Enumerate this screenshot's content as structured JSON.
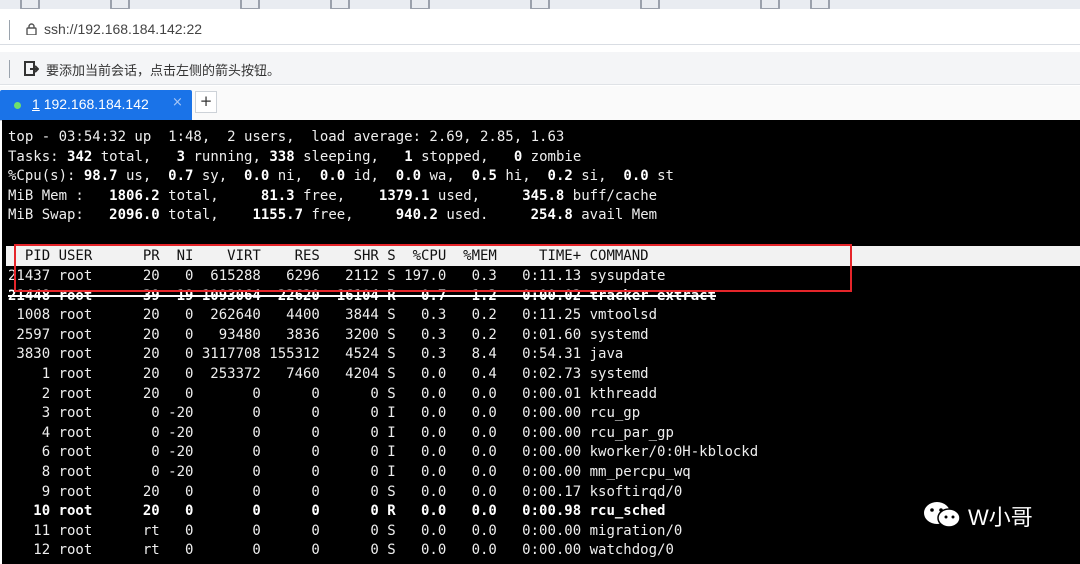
{
  "address": {
    "url": "ssh://192.168.184.142:22"
  },
  "hint": {
    "text": "要添加当前会话，点击左侧的箭头按钮。"
  },
  "tab": {
    "number": "1",
    "host": "192.168.184.142",
    "close": "×",
    "new": "+"
  },
  "terminal": {
    "summary": [
      [
        {
          "t": "top - 03:54:32 up  1:48,  2 users,  load average: 2.69, 2.85, 1.63"
        }
      ],
      [
        {
          "t": "Tasks: "
        },
        {
          "t": "342",
          "b": true
        },
        {
          "t": " total,   "
        },
        {
          "t": "3",
          "b": true
        },
        {
          "t": " running, "
        },
        {
          "t": "338",
          "b": true
        },
        {
          "t": " sleeping,   "
        },
        {
          "t": "1",
          "b": true
        },
        {
          "t": " stopped,   "
        },
        {
          "t": "0",
          "b": true
        },
        {
          "t": " zombie"
        }
      ],
      [
        {
          "t": "%Cpu(s): "
        },
        {
          "t": "98.7",
          "b": true
        },
        {
          "t": " us,  "
        },
        {
          "t": "0.7",
          "b": true
        },
        {
          "t": " sy,  "
        },
        {
          "t": "0.0",
          "b": true
        },
        {
          "t": " ni,  "
        },
        {
          "t": "0.0",
          "b": true
        },
        {
          "t": " id,  "
        },
        {
          "t": "0.0",
          "b": true
        },
        {
          "t": " wa,  "
        },
        {
          "t": "0.5",
          "b": true
        },
        {
          "t": " hi,  "
        },
        {
          "t": "0.2",
          "b": true
        },
        {
          "t": " si,  "
        },
        {
          "t": "0.0",
          "b": true
        },
        {
          "t": " st"
        }
      ],
      [
        {
          "t": "MiB Mem :   "
        },
        {
          "t": "1806.2",
          "b": true
        },
        {
          "t": " total,     "
        },
        {
          "t": "81.3",
          "b": true
        },
        {
          "t": " free,    "
        },
        {
          "t": "1379.1",
          "b": true
        },
        {
          "t": " used,     "
        },
        {
          "t": "345.8",
          "b": true
        },
        {
          "t": " buff/cache"
        }
      ],
      [
        {
          "t": "MiB Swap:   "
        },
        {
          "t": "2096.0",
          "b": true
        },
        {
          "t": " total,    "
        },
        {
          "t": "1155.7",
          "b": true
        },
        {
          "t": " free,     "
        },
        {
          "t": "940.2",
          "b": true
        },
        {
          "t": " used.     "
        },
        {
          "t": "254.8",
          "b": true
        },
        {
          "t": " avail Mem"
        }
      ]
    ],
    "header": "  PID USER      PR  NI    VIRT    RES    SHR S  %CPU  %MEM     TIME+ COMMAND",
    "rows": [
      {
        "t": "21437 root      20   0  615288   6296   2112 S 197.0   0.3   0:11.13 sysupdate"
      },
      {
        "t": "21448 root      39  19 1093064  22620  16104 R   0.7   1.2   0:00.02 tracker-extract",
        "style": "strike"
      },
      {
        "t": " 1008 root      20   0  262640   4400   3844 S   0.3   0.2   0:11.25 vmtoolsd"
      },
      {
        "t": " 2597 root      20   0   93480   3836   3200 S   0.3   0.2   0:01.60 systemd"
      },
      {
        "t": " 3830 root      20   0 3117708 155312   4524 S   0.3   8.4   0:54.31 java"
      },
      {
        "t": "    1 root      20   0  253372   7460   4204 S   0.0   0.4   0:02.73 systemd"
      },
      {
        "t": "    2 root      20   0       0      0      0 S   0.0   0.0   0:00.01 kthreadd"
      },
      {
        "t": "    3 root       0 -20       0      0      0 I   0.0   0.0   0:00.00 rcu_gp"
      },
      {
        "t": "    4 root       0 -20       0      0      0 I   0.0   0.0   0:00.00 rcu_par_gp"
      },
      {
        "t": "    6 root       0 -20       0      0      0 I   0.0   0.0   0:00.00 kworker/0:0H-kblockd"
      },
      {
        "t": "    8 root       0 -20       0      0      0 I   0.0   0.0   0:00.00 mm_percpu_wq"
      },
      {
        "t": "    9 root      20   0       0      0      0 S   0.0   0.0   0:00.17 ksoftirqd/0"
      },
      {
        "t": "   10 root      20   0       0      0      0 R   0.0   0.0   0:00.98 rcu_sched",
        "style": "bold"
      },
      {
        "t": "   11 root      rt   0       0      0      0 S   0.0   0.0   0:00.00 migration/0"
      },
      {
        "t": "   12 root      rt   0       0      0      0 S   0.0   0.0   0:00.00 watchdog/0"
      }
    ]
  },
  "watermark": {
    "text": "W小哥"
  },
  "colors": {
    "tab_active": "#1a73e8",
    "highlight": "#e5252a",
    "terminal_bg": "#000000"
  }
}
